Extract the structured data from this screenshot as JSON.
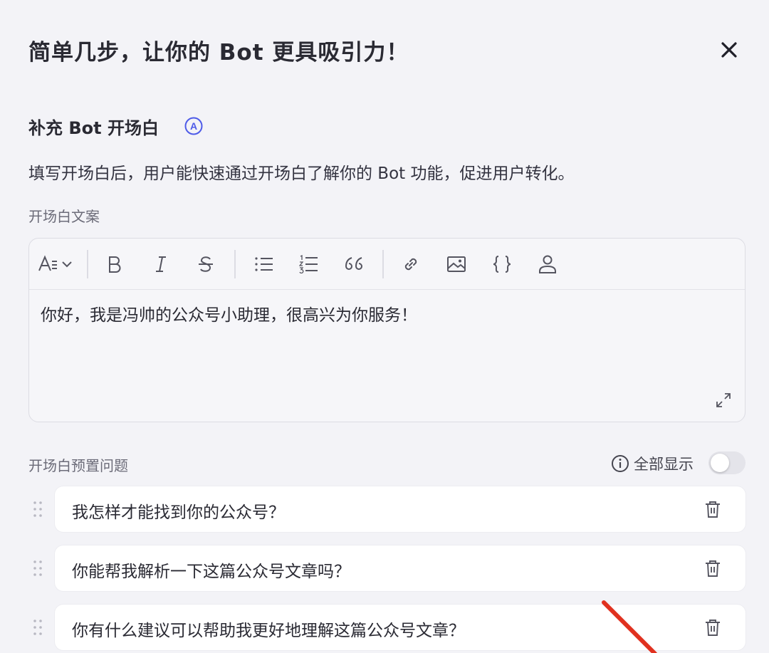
{
  "dialog": {
    "title": "简单几步，让你的 Bot 更具吸引力！"
  },
  "section": {
    "title": "补充 Bot 开场白",
    "badge": "A",
    "description": "填写开场白后，用户能快速通过开场白了解你的 Bot 功能，促进用户转化。"
  },
  "editor": {
    "label": "开场白文案",
    "content": "你好，我是冯帅的公众号小助理，很高兴为你服务！",
    "toolbar": [
      "text-style",
      "bold",
      "italic",
      "strikethrough",
      "bullet-list",
      "numbered-list",
      "quote",
      "link",
      "image",
      "code",
      "mention"
    ]
  },
  "presets": {
    "label": "开场白预置问题",
    "show_all_label": "全部显示",
    "show_all_enabled": false,
    "questions": [
      "我怎样才能找到你的公众号？",
      "你能帮我解析一下这篇公众号文章吗？",
      "你有什么建议可以帮助我更好地理解这篇公众号文章？"
    ]
  },
  "colors": {
    "accent": "#4e5be8",
    "annotation_arrow": "#e0311f"
  }
}
